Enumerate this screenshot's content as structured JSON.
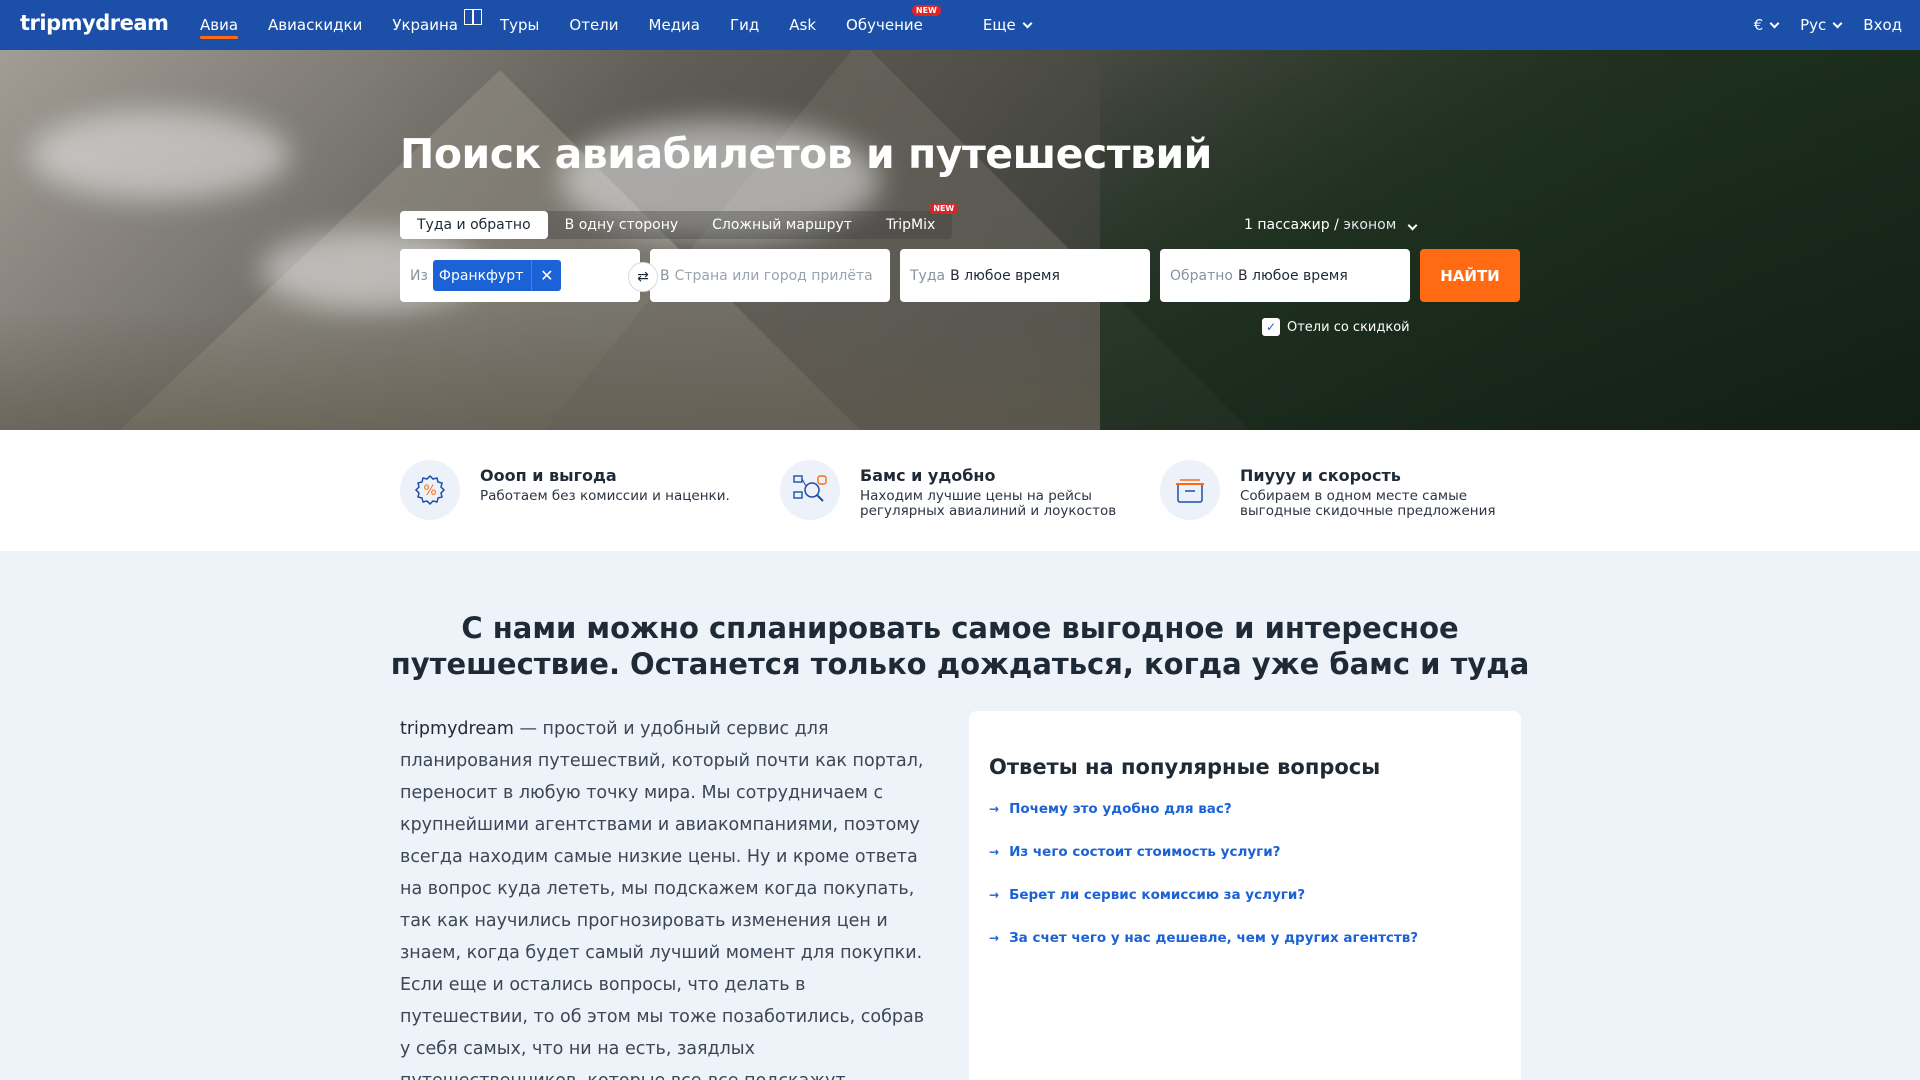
{
  "nav": {
    "logo": "tripmydream",
    "items": [
      {
        "label": "Авиа",
        "active": true
      },
      {
        "label": "Авиаскидки"
      },
      {
        "label": "Украина"
      },
      {
        "label": "Туры"
      },
      {
        "label": "Отели"
      },
      {
        "label": "Медиа"
      },
      {
        "label": "Гид"
      },
      {
        "label": "Ask"
      },
      {
        "label": "Обучение",
        "badge": "NEW"
      },
      {
        "label": "Еще"
      }
    ],
    "currency": "€",
    "language": "Рус",
    "login": "Вход"
  },
  "hero": {
    "title": "Поиск авиабилетов и путешествий",
    "tabs": [
      {
        "label": "Туда и обратно",
        "active": true
      },
      {
        "label": "В одну сторону"
      },
      {
        "label": "Сложный маршрут"
      },
      {
        "label": "TripMix",
        "badge": "NEW"
      }
    ],
    "passengers": "1 пассажир",
    "separator": "/",
    "cabin": "эконом",
    "from": {
      "prefix": "Из",
      "value": "Франкфурт"
    },
    "to": {
      "prefix": "В",
      "placeholder": "Страна или город прилёта"
    },
    "depart": {
      "prefix": "Туда",
      "value": "В любое время"
    },
    "return": {
      "prefix": "Обратно",
      "value": "В любое время"
    },
    "search_button": "НАЙТИ",
    "hotels_checkbox": {
      "label": "Отели со скидкой",
      "checked": true
    }
  },
  "features": [
    {
      "icon": "percent-icon",
      "title": "Оооп и выгода",
      "desc": "Работаем без комиссии и наценки."
    },
    {
      "icon": "search-compare-icon",
      "title": "Бамс и удобно",
      "desc_line1": "Находим лучшие цены на рейсы",
      "desc_line2": "регулярных авиалиний и лоукостов"
    },
    {
      "icon": "box-icon",
      "title": "Пиууу и скорость",
      "desc_line1": "Собираем в одном месте самые",
      "desc_line2": "выгодные скидочные предложения"
    }
  ],
  "main": {
    "heading_line1": "С нами можно спланировать самое выгодное и интересное",
    "heading_line2": "путешествие. Останется только дождаться, когда уже бамс и туда",
    "about_brand": "tripmydream",
    "about_text": " — простой и удобный сервис для планирования путешествий, который почти как портал, переносит в любую точку мира. Мы сотрудничаем с крупнейшими агентствами и авиакомпаниями, поэтому всегда находим самые низкие цены. Ну и кроме ответа на вопрос куда лететь, мы подскажем когда покупать, так как научились прогнозировать изменения цен и знаем, когда будет самый лучший момент для покупки. Если еще и остались вопросы, что делать в путешествии, то об этом мы тоже позаботились, собрав у себя самых, что ни на есть, заядлых путешественников, которые все-все подскажут."
  },
  "faq": {
    "title": "Ответы на популярные вопросы",
    "items": [
      "Почему это удобно для вас?",
      "Из чего состоит стоимость услуги?",
      "Берет ли сервис комиссию за услуги?",
      "За счет чего у нас дешевле, чем у других агентств?"
    ]
  },
  "colors": {
    "nav_bg": "#1b4fa8",
    "accent": "#ff6a13",
    "link": "#1b62d6",
    "badge": "#e02424"
  }
}
